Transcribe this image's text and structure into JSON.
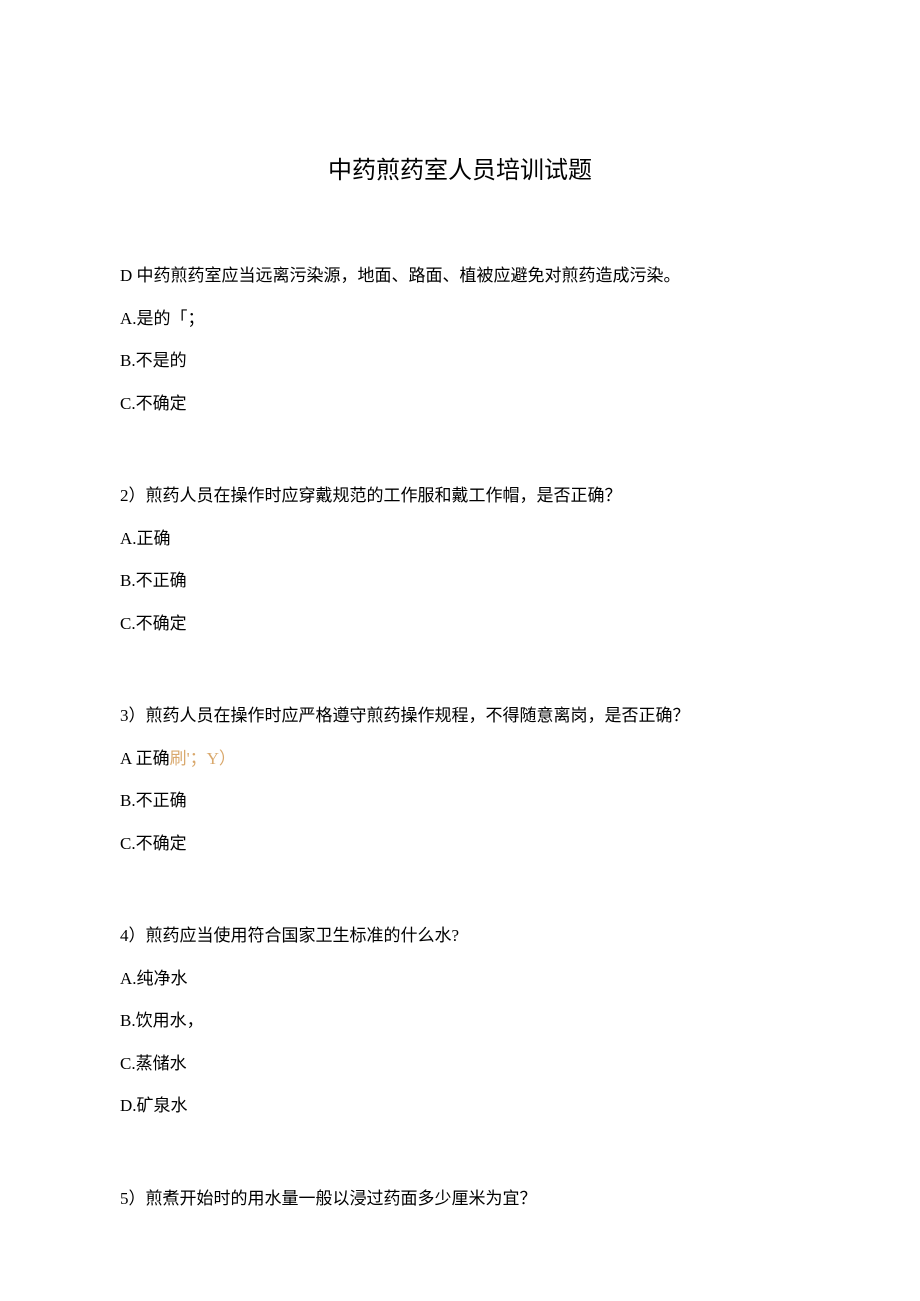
{
  "title": "中药煎药室人员培训试题",
  "questions": [
    {
      "prompt": "D 中药煎药室应当远离污染源，地面、路面、植被应避免对煎药造成污染。",
      "options": [
        {
          "label": "A.是的「；",
          "annotation": ""
        },
        {
          "label": "B.不是的",
          "annotation": ""
        },
        {
          "label": "C.不确定",
          "annotation": ""
        }
      ]
    },
    {
      "prompt": "2）煎药人员在操作时应穿戴规范的工作服和戴工作帽，是否正确？",
      "options": [
        {
          "label": "A.正确",
          "annotation": ""
        },
        {
          "label": "B.不正确",
          "annotation": ""
        },
        {
          "label": "C.不确定",
          "annotation": ""
        }
      ]
    },
    {
      "prompt": "3）煎药人员在操作时应严格遵守煎药操作规程，不得随意离岗，是否正确？",
      "options": [
        {
          "label": "A 正确",
          "annotation": "刷'；Y）"
        },
        {
          "label": "B.不正确",
          "annotation": ""
        },
        {
          "label": "C.不确定",
          "annotation": ""
        }
      ]
    },
    {
      "prompt": "4）煎药应当使用符合国家卫生标准的什么水?",
      "options": [
        {
          "label": "A.纯净水",
          "annotation": ""
        },
        {
          "label": "B.饮用水，",
          "annotation": ""
        },
        {
          "label": "C.蒸储水",
          "annotation": ""
        },
        {
          "label": "D.矿泉水",
          "annotation": ""
        }
      ]
    },
    {
      "prompt": "5）煎煮开始时的用水量一般以浸过药面多少厘米为宜？",
      "options": []
    }
  ]
}
